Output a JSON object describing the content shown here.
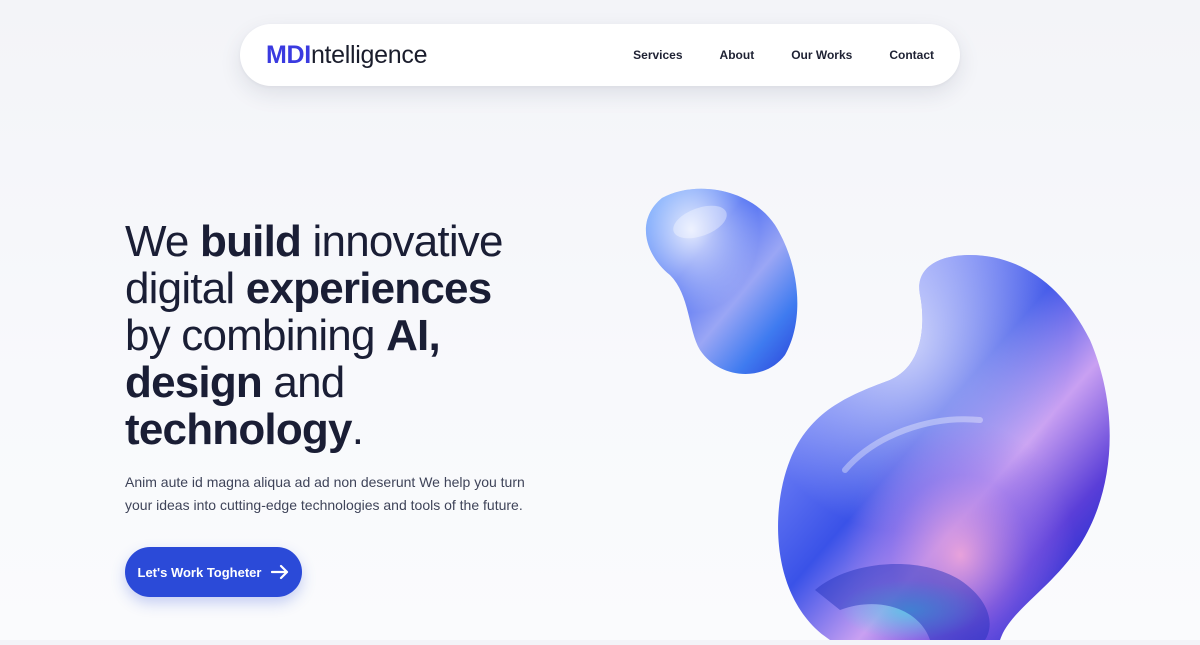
{
  "brand": {
    "accent": "MDI",
    "rest": "ntelligence",
    "accent_color": "#3a3ae0"
  },
  "nav": {
    "links": [
      {
        "label": "Services"
      },
      {
        "label": "About"
      },
      {
        "label": "Our Works"
      },
      {
        "label": "Contact"
      }
    ]
  },
  "hero": {
    "headline": {
      "w1": "We ",
      "w2": "build",
      "w3": " innovative",
      "w4": "digital ",
      "w5": "experiences",
      "w6": "by combining ",
      "w7": "AI,",
      "w8": "design",
      "w9": " and",
      "w10": "technology",
      "w11": "."
    },
    "subtext": "Anim aute id magna aliqua ad ad non deserunt We help you turn your ideas into cutting-edge technologies and tools of the future.",
    "cta_label": "Let's Work Togheter",
    "cta_color": "#2b4ad8"
  },
  "icons": {
    "cta": "arrow-right-icon",
    "art": "abstract-3d-blob-illustration"
  }
}
